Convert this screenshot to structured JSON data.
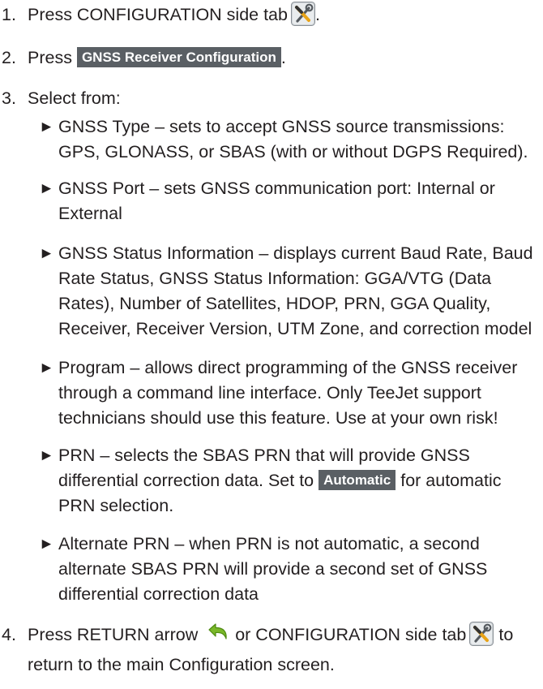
{
  "steps": [
    {
      "num": "1.",
      "pre": "Press CONFIGURATION side tab",
      "icon": "configuration-tools-icon",
      "post": "."
    },
    {
      "num": "2.",
      "pre": "Press",
      "button": "GNSS Receiver Configuration",
      "post": "."
    },
    {
      "num": "3.",
      "text": "Select from:"
    },
    {
      "num": "4.",
      "pre": "Press RETURN arrow",
      "mid": "or CONFIGURATION side tab",
      "post": "to",
      "line2": "return to the main Configuration screen."
    }
  ],
  "bullets": [
    {
      "lines": [
        "GNSS Type – sets to accept GNSS source transmissions:",
        "GPS, GLONASS, or SBAS (with or without DGPS Required)."
      ]
    },
    {
      "lines": [
        "GNSS Port – sets GNSS communication port: Internal or",
        "External"
      ]
    },
    {
      "lines": [
        "GNSS Status Information – displays current Baud Rate, Baud",
        "Rate Status, GNSS Status Information: GGA/VTG (Data",
        "Rates), Number of Satellites, HDOP, PRN, GGA Quality,",
        "Receiver, Receiver Version, UTM Zone, and correction model"
      ]
    },
    {
      "lines": [
        "Program – allows direct programming of the GNSS receiver",
        "through a command line interface. Only TeeJet support",
        "technicians should use this feature. Use at your own risk!"
      ]
    },
    {
      "line1": "PRN – selects the SBAS PRN that will provide GNSS",
      "line2_pre": "differential correction data. Set to",
      "button": "Automatic",
      "line2_post": "for automatic",
      "line3": "PRN selection."
    },
    {
      "lines": [
        "Alternate PRN – when PRN is not automatic, a second",
        "alternate SBAS PRN will provide a second set of GNSS",
        "differential correction data"
      ]
    }
  ],
  "bullet_marker": "►",
  "colors": {
    "text": "#231f20",
    "button_bg": "#5a5f64",
    "button_text": "#ffffff",
    "return_arrow": "#7ab829"
  }
}
